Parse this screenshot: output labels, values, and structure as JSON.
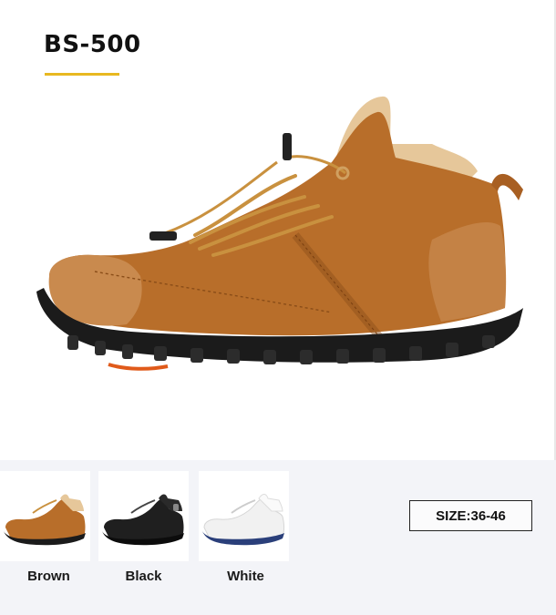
{
  "product": {
    "model": "BS-500"
  },
  "colors": {
    "accent": "#e8b820",
    "brown": "#c07a34",
    "black": "#1b1b1b",
    "white": "#f4f4f4",
    "sole_white_trim": "#2a3f7a"
  },
  "variants": [
    {
      "label": "Brown"
    },
    {
      "label": "Black"
    },
    {
      "label": "White"
    }
  ],
  "size": {
    "label": "SIZE:36-46"
  }
}
